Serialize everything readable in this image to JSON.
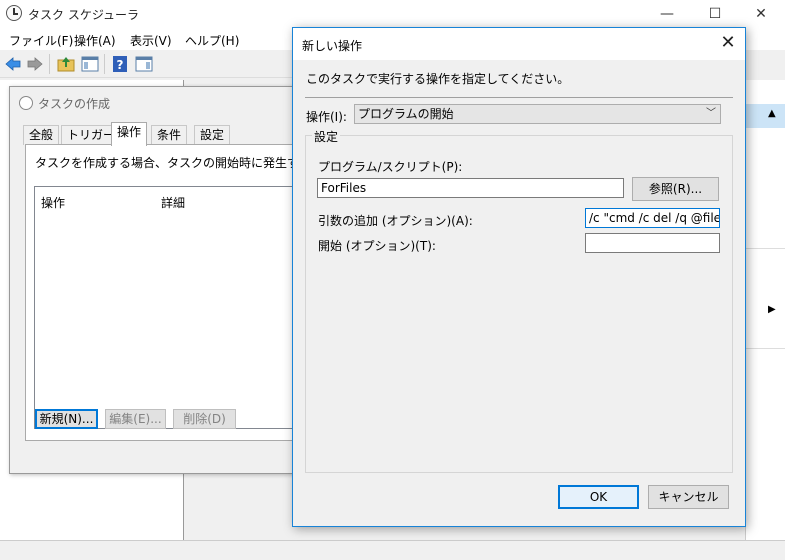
{
  "main_window": {
    "title": "タスク スケジューラ",
    "menu": [
      "ファイル(F)",
      "操作(A)",
      "表示(V)",
      "ヘルプ(H)"
    ],
    "window_controls": {
      "minimize": "—",
      "maximize": "☐",
      "close": "✕"
    },
    "right_pane_arrows": {
      "up": "▲",
      "right": "▶"
    }
  },
  "create_task": {
    "title": "タスクの作成",
    "tabs": [
      "全般",
      "トリガー",
      "操作",
      "条件",
      "設定"
    ],
    "active_tab": "操作",
    "description": "タスクを作成する場合、タスクの開始時に発生する操作",
    "columns": [
      "操作",
      "詳細"
    ],
    "buttons": {
      "new": "新規(N)...",
      "edit": "編集(E)...",
      "delete": "削除(D)"
    }
  },
  "new_action": {
    "title": "新しい操作",
    "close": "✕",
    "instruction": "このタスクで実行する操作を指定してください。",
    "action_label": "操作(I):",
    "action_value": "プログラムの開始",
    "action_chevron": "﹀",
    "settings_label": "設定",
    "program_label": "プログラム/スクリプト(P):",
    "program_value": "ForFiles",
    "browse_button": "参照(R)...",
    "args_label": "引数の追加 (オプション)(A):",
    "args_value": "/c \"cmd /c del /q @file\"",
    "start_label": "開始 (オプション)(T):",
    "start_value": "",
    "ok_button": "OK",
    "cancel_button": "キャンセル"
  },
  "colors": {
    "accent": "#0078d7",
    "selection": "#cce4f7"
  }
}
